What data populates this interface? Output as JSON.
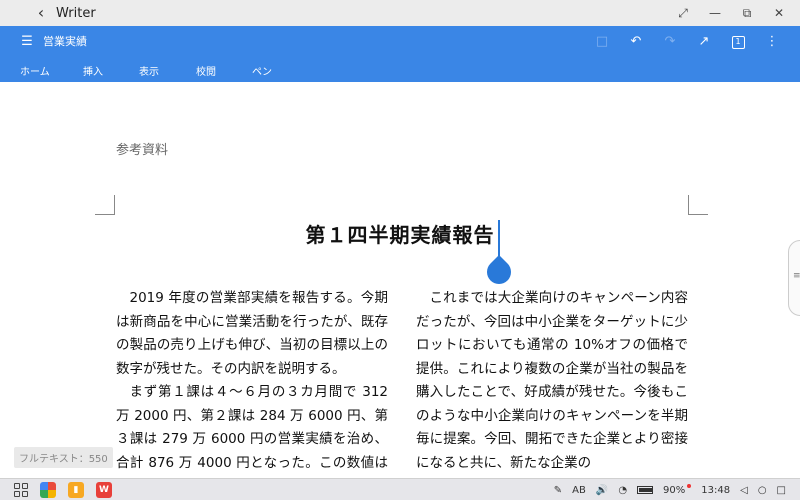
{
  "window": {
    "back_icon": "chevron-left-icon",
    "app_title": "Writer",
    "controls": [
      "expand-icon",
      "minimize-icon",
      "restore-icon",
      "close-icon"
    ]
  },
  "toolbar": {
    "doc_title": "営業実績",
    "icons": [
      "save-icon",
      "undo-icon",
      "redo-icon",
      "share-icon",
      "page-icon",
      "more-icon"
    ],
    "page_badge": "1"
  },
  "ribbon": {
    "tabs": [
      "ホーム",
      "挿入",
      "表示",
      "校閲",
      "ペン"
    ]
  },
  "document": {
    "header": "参考資料",
    "title": "第１四半期実績報告",
    "left_column": [
      "2019 年度の営業部実績を報告する。今期は新商品を中心に営業活動を行ったが、既存の製品の売り上げも伸び、当初の目標以上の数字が残せた。その内訳を説明する。",
      "まず第１課は４〜６月の３カ月間で 312 万 2000 円、第２課は 284 万 6000 円、第３課は 279 万 6000 円の営業実績を治め、合計 876 万 4000 円となった。この数値は昨"
    ],
    "right_column": [
      "これまでは大企業向けのキャンペーン内容だったが、今回は中小企業をターゲットに少ロットにおいても通常の 10%オフの価格で提供。これにより複数の企業が当社の製品を購入したことで、好成績が残せた。今後もこのような中小企業向けのキャンペーンを半期毎に提案。今回、開拓できた企業とより密接になると共に、新たな企業の"
    ]
  },
  "status": {
    "word_count": "フルテキスト：550"
  },
  "taskbar": {
    "pinned_apps": [
      "grid-icon",
      "pinwheel-app-icon",
      "folder-app-icon",
      "wps-app-icon"
    ],
    "pen_icon": "pen-icon",
    "input_mode": "AB",
    "battery": "90%",
    "time": "13:48"
  },
  "colors": {
    "accent": "#3a86e6",
    "cursor": "#2979d9",
    "taskbar": "#e6e6ea"
  }
}
